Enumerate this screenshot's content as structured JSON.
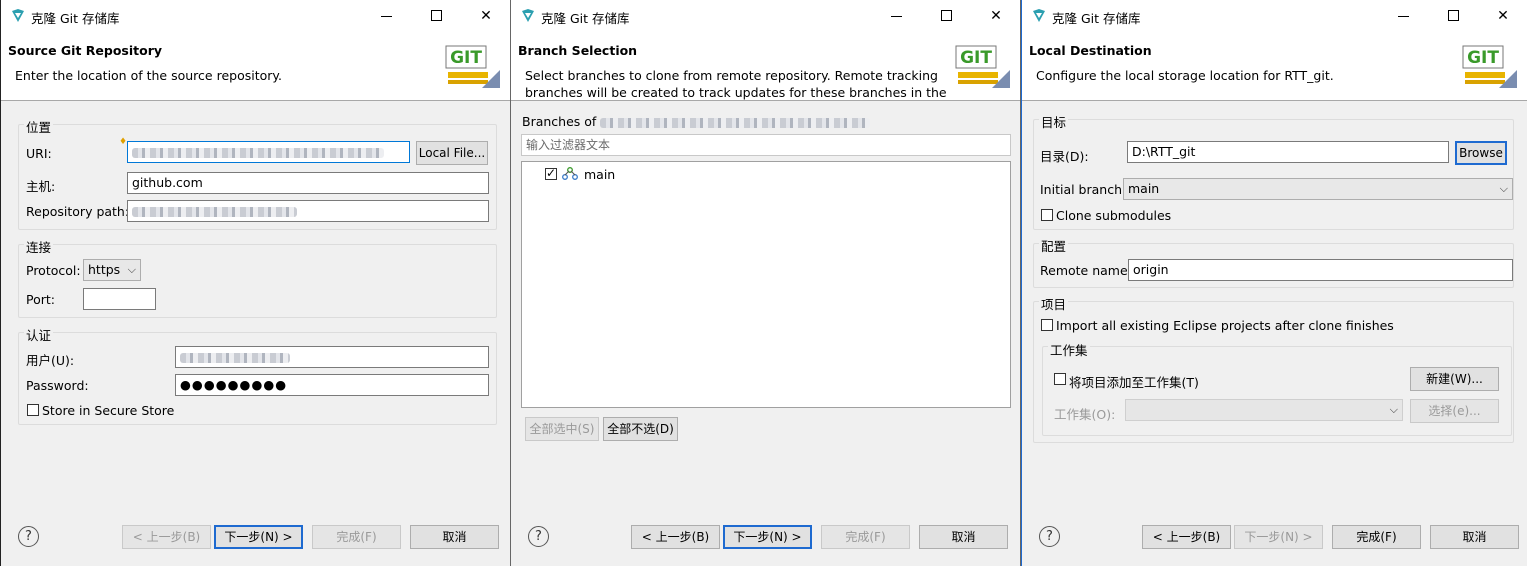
{
  "window_title": "克隆 Git 存储库",
  "git_logo_text": "GIT",
  "help_symbol": "?",
  "arrow_down": "⌵",
  "colors": {
    "accent": "#1e6ad0",
    "logo_teal": "#2b9fb0",
    "git_green": "#3a9a2a"
  },
  "page1": {
    "title": "Source Git Repository",
    "description": "Enter the location of the source repository.",
    "location_group": "位置",
    "uri_label": "URI:",
    "uri_value": "",
    "local_file_button": "Local File...",
    "host_label": "主机:",
    "host_value": "github.com",
    "repo_path_label": "Repository path:",
    "connection_group": "连接",
    "protocol_label": "Protocol:",
    "protocol_value": "https",
    "port_label": "Port:",
    "port_value": "",
    "auth_group": "认证",
    "user_label": "用户(U):",
    "password_label": "Password:",
    "password_value": "●●●●●●●●●",
    "store_label": "Store in Secure Store"
  },
  "page2": {
    "title": "Branch Selection",
    "description": "Select branches to clone from remote repository. Remote tracking\nbranches will be created to track updates for these branches in the",
    "branches_of_label": "Branches of",
    "filter_placeholder": "输入过滤器文本",
    "branch": "main",
    "select_all_button": "全部选中(S)",
    "deselect_all_button": "全部不选(D)"
  },
  "page3": {
    "title": "Local Destination",
    "description": "Configure the local storage location for RTT_git.",
    "destination_group": "目标",
    "directory_label": "目录(D):",
    "directory_value": "D:\\RTT_git",
    "browse_button": "Browse",
    "initial_branch_label": "Initial branch:",
    "initial_branch_value": "main",
    "clone_submodules_label": "Clone submodules",
    "config_group": "配置",
    "remote_name_label": "Remote name:",
    "remote_name_value": "origin",
    "projects_group": "项目",
    "import_label": "Import all existing Eclipse projects after clone finishes",
    "working_sets_group": "工作集",
    "add_to_ws_label": "将项目添加至工作集(T)",
    "new_button": "新建(W)...",
    "ws_label": "工作集(O):",
    "select_button": "选择(e)..."
  },
  "footer": {
    "back": "< 上一步(B)",
    "next": "下一步(N) >",
    "finish": "完成(F)",
    "cancel": "取消"
  }
}
